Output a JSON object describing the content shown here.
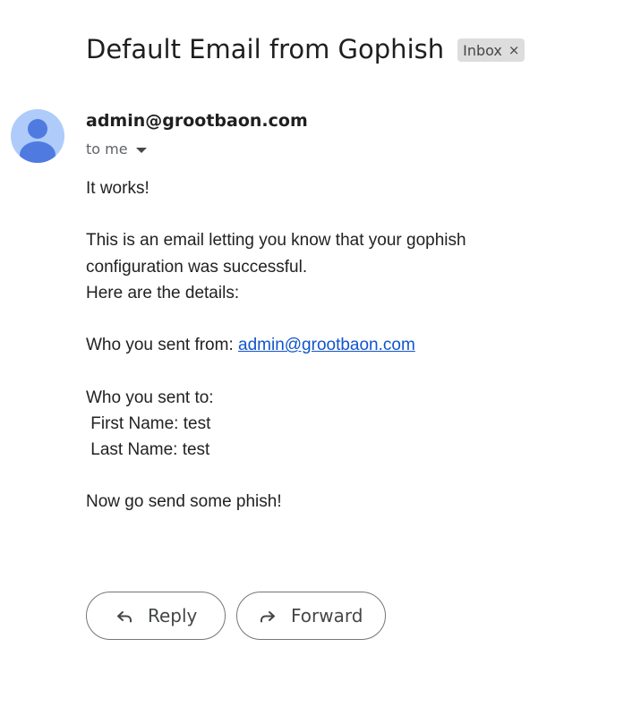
{
  "subject": {
    "title": "Default Email from Gophish",
    "label": "Inbox",
    "label_close": "×"
  },
  "sender": {
    "address": "admin@grootbaon.com",
    "recipient_text": "to me"
  },
  "body": {
    "lines": [
      "It works!",
      "",
      "This is an email letting you know that your gophish",
      "configuration was successful.",
      "Here are the details:",
      "",
      "Who you sent from: ",
      "",
      "Who you sent to:",
      " First Name: test",
      " Last Name: test",
      "",
      "Now go send some phish!"
    ],
    "from_prefix": "Who you sent from: ",
    "from_link": "admin@grootbaon.com"
  },
  "actions": {
    "reply_label": "Reply",
    "forward_label": "Forward"
  },
  "icons": {
    "avatar": "person-icon",
    "reply": "reply-arrow-icon",
    "forward": "forward-arrow-icon",
    "recipient_caret": "caret-down-icon",
    "label_close": "close-icon"
  },
  "colors": {
    "link": "#1155cc",
    "avatar_bg": "#aecbfa",
    "avatar_fg": "#4f7be0",
    "chip_bg": "#dddddd"
  }
}
